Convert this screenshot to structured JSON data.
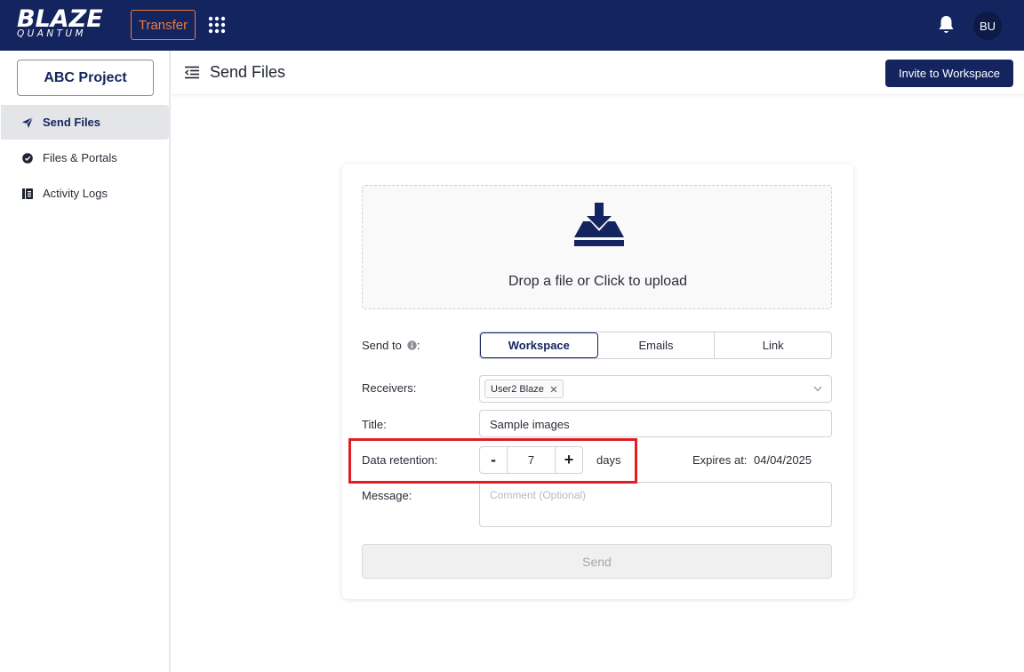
{
  "topbar": {
    "logo_main": "BLAZE",
    "logo_sub": "QUANTUM",
    "transfer_label": "Transfer",
    "avatar_initials": "BU",
    "icons": {
      "apps": "apps-grid-icon",
      "notifications": "bell-icon"
    }
  },
  "sidebar": {
    "project_label": "ABC Project",
    "items": [
      {
        "label": "Send Files",
        "icon": "send-icon",
        "active": true
      },
      {
        "label": "Files & Portals",
        "icon": "files-icon",
        "active": false
      },
      {
        "label": "Activity Logs",
        "icon": "activity-log-icon",
        "active": false
      }
    ]
  },
  "header": {
    "title": "Send Files",
    "invite_label": "Invite to Workspace"
  },
  "upload": {
    "text": "Drop a file or Click to upload"
  },
  "form": {
    "send_to_label": "Send to",
    "send_to_colon": ":",
    "send_to_options": [
      "Workspace",
      "Emails",
      "Link"
    ],
    "send_to_selected": "Workspace",
    "receivers_label": "Receivers:",
    "receivers": [
      "User2 Blaze"
    ],
    "title_label": "Title:",
    "title_value": "Sample images",
    "retention_label": "Data retention:",
    "retention_minus": "-",
    "retention_value": "7",
    "retention_plus": "+",
    "retention_unit": "days",
    "expires_label": "Expires at:",
    "expires_value": "04/04/2025",
    "message_label": "Message:",
    "message_placeholder": "Comment (Optional)",
    "send_label": "Send"
  },
  "colors": {
    "brand_navy": "#13245f",
    "accent_orange": "#f07a3c",
    "highlight_red": "#e01e26"
  }
}
